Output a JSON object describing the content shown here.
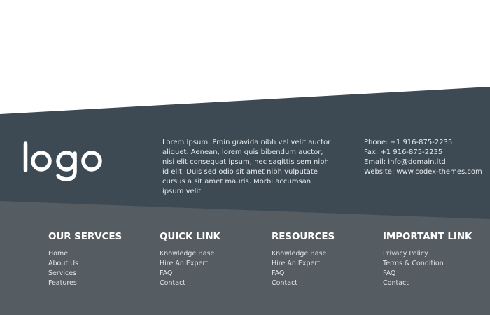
{
  "brand": {
    "logo_text": "logo"
  },
  "about": {
    "text": "Lorem Ipsum. Proin gravida nibh vel velit auctor aliquet. Aenean, lorem quis bibendum auctor, nisi elit consequat ipsum, nec sagittis sem nibh id elit. Duis sed odio sit amet nibh vulputate cursus a sit amet mauris. Morbi accumsan ipsum velit."
  },
  "contact": {
    "phone": "Phone: +1 916-875-2235",
    "fax": "Fax: +1 916-875-2235",
    "email": "Email: info@domain.ltd",
    "website": "Website: www.codex-themes.com"
  },
  "columns": [
    {
      "title": "OUR SERVCES",
      "links": [
        "Home",
        "About Us",
        "Services",
        "Features"
      ]
    },
    {
      "title": "QUICK LINK",
      "links": [
        "Knowledge Base",
        "Hire An Expert",
        "FAQ",
        "Contact"
      ]
    },
    {
      "title": "RESOURCES",
      "links": [
        "Knowledge Base",
        "Hire An Expert",
        "FAQ",
        "Contact"
      ]
    },
    {
      "title": "IMPORTANT LINK",
      "links": [
        "Privacy Policy",
        "Terms & Condition",
        "FAQ",
        "Contact"
      ]
    }
  ],
  "colors": {
    "upper_band": "#3d4a53",
    "lower_band": "#555c62",
    "text": "#e6eaed",
    "heading": "#ffffff"
  }
}
